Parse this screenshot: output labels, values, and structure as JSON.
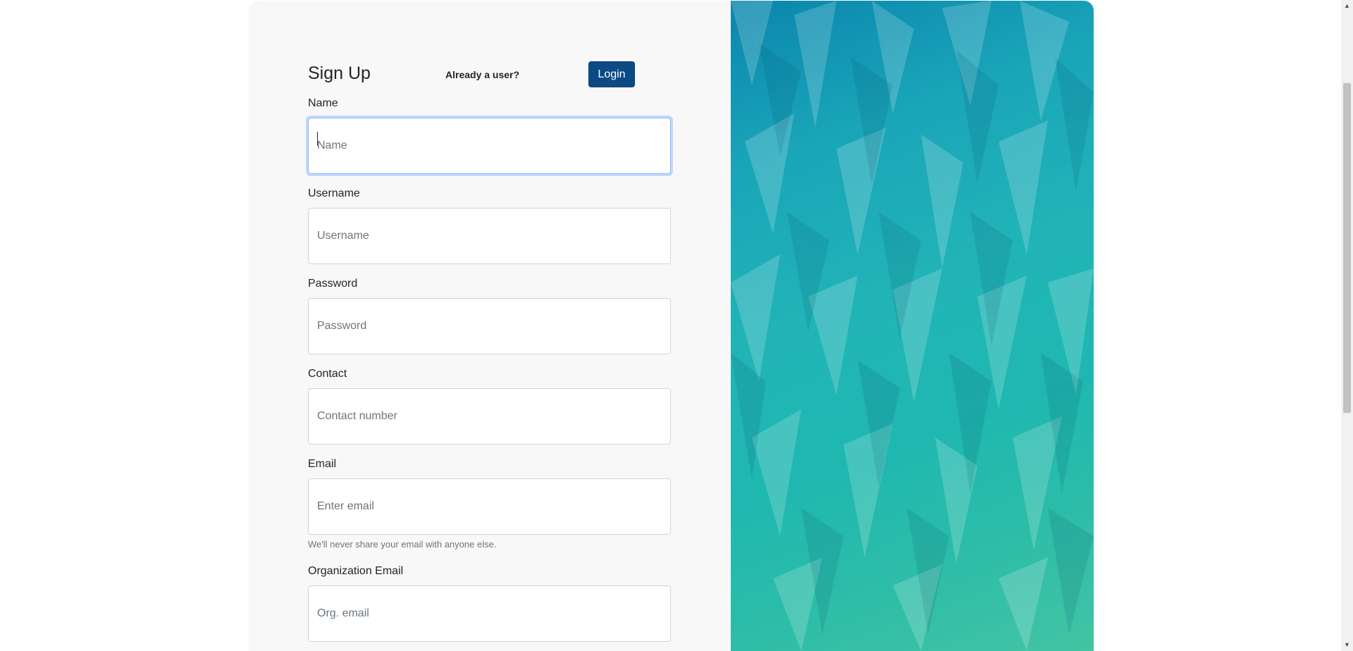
{
  "header": {
    "title": "Sign Up",
    "already_user_text": "Already a user?",
    "login_button_label": "Login"
  },
  "form": {
    "fields": [
      {
        "label": "Name",
        "placeholder": "Name",
        "value": "",
        "focused": true
      },
      {
        "label": "Username",
        "placeholder": "Username",
        "value": ""
      },
      {
        "label": "Password",
        "placeholder": "Password",
        "value": ""
      },
      {
        "label": "Contact",
        "placeholder": "Contact number",
        "value": ""
      },
      {
        "label": "Email",
        "placeholder": "Enter email",
        "value": "",
        "help": "We'll never share your email with anyone else."
      },
      {
        "label": "Organization Email",
        "placeholder": "Org. email",
        "value": ""
      }
    ]
  },
  "colors": {
    "login_button": "#0c4a86",
    "focus_ring": "#86b7fe",
    "art_gradient_start": "#0a86ad",
    "art_gradient_end": "#43c4a4"
  },
  "scrollbar": {
    "up_icon": "scroll-up-arrow-icon",
    "down_icon": "scroll-down-arrow-icon"
  }
}
